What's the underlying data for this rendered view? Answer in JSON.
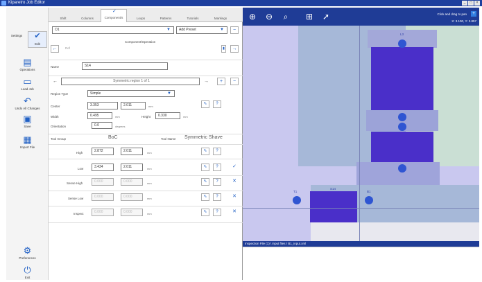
{
  "window": {
    "title": "Kiparetro Job Editor",
    "controls": [
      "_",
      "□",
      "×"
    ]
  },
  "leftbar": {
    "items": [
      {
        "label": "Settings"
      },
      {
        "label": "Edit"
      },
      {
        "label": "Operations"
      },
      {
        "label": "Load Job"
      },
      {
        "label": "Undo All Changes"
      },
      {
        "label": "Save"
      },
      {
        "label": "Import File"
      },
      {
        "label": "Preferences"
      },
      {
        "label": "Exit"
      }
    ]
  },
  "tabs": [
    "Shift",
    "Columns",
    "Component/s",
    "Loops",
    "Patterns",
    "Tutorials",
    "Markings"
  ],
  "panel": {
    "top_dropdown": "O1",
    "add_preset": "Add Preset",
    "section_title": "Component/Operation",
    "sub_label": "Ref",
    "name_label": "Name",
    "name_value": "S14",
    "region_nav": "Symmetric region 1 of 1",
    "region_type_label": "Region Type",
    "region_type_value": "Simple",
    "center_label": "Center",
    "center_x": "3.353",
    "center_y": "2.011",
    "center_unit": "mm",
    "width_label": "Width",
    "width_value": "0.495",
    "width_unit": "mm",
    "height_label": "Height",
    "height_value": "0.330",
    "height_unit": "mm",
    "orientation_label": "Orientation",
    "orientation_value": "0.0",
    "orientation_unit": "degrees",
    "tool_group_label": "Tool Group",
    "tool_group_value": "BoC",
    "tool_name_label": "Tool Name",
    "tool_name_value": "Symmetric Shave",
    "high_label": "High",
    "high_x": "2.872",
    "high_y": "2.011",
    "low_label": "Low",
    "low_x": "3.434",
    "low_y": "2.011",
    "sense_high_label": "Sense High",
    "sense_high_x": "0.000",
    "sense_high_y": "0.000",
    "sense_low_label": "Sense Low",
    "sense_low_x": "0.000",
    "sense_low_y": "0.000",
    "inspect_label": "Inspect",
    "inspect_x": "0.000",
    "inspect_y": "0.000",
    "unit_mm": "mm"
  },
  "viewer": {
    "hint": "Click and drag to pan",
    "coords": "X: 3.100, Y: 2.857",
    "labels": {
      "top_dot": "L3",
      "left_dot": "T1",
      "s14": "S14",
      "right_dot": "B1"
    },
    "status_path": "Inspection File (1) \\ input files \\ B1_input.xml"
  },
  "colors": {
    "titlebar": "#1d3f9e",
    "accent": "#1f5fc4",
    "viewer_tool": "#1f3c96",
    "part": "#4a2fc9",
    "dot": "#2f55d2"
  }
}
